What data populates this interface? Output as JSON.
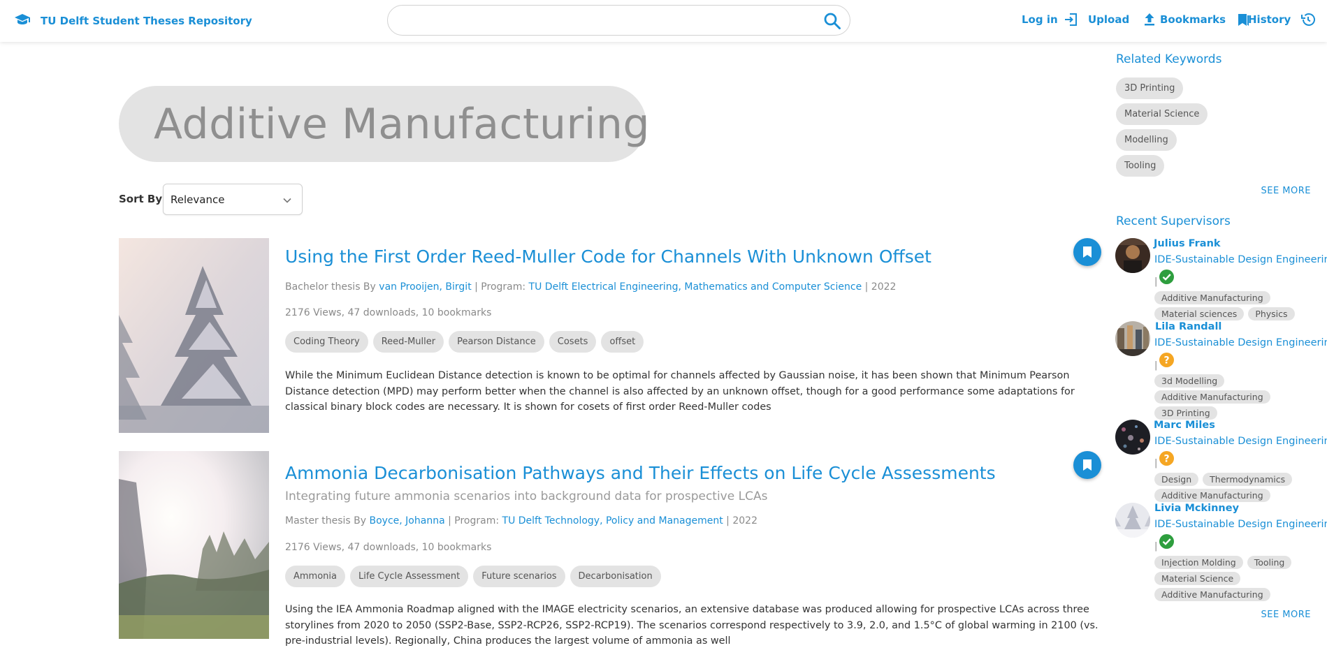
{
  "header": {
    "brand": "TU Delft Student Theses Repository",
    "search": {
      "value": "",
      "placeholder": ""
    },
    "nav": [
      {
        "label": "Log in",
        "icon": "login-icon"
      },
      {
        "label": "Upload",
        "icon": "upload-icon"
      },
      {
        "label": "Bookmarks",
        "icon": "bookmarks-icon"
      },
      {
        "label": "History",
        "icon": "history-icon"
      }
    ]
  },
  "main": {
    "heading": "Additive Manufacturing",
    "sort": {
      "label": "Sort By",
      "selected": "Relevance"
    },
    "results": [
      {
        "title": "Using the First Order Reed-Muller Code for Channels With Unknown Offset",
        "subtitle": "",
        "type_prefix": "Bachelor thesis By ",
        "author": "van Prooijen, Birgit",
        "program_prefix": " | Program: ",
        "program": "TU Delft Electrical Engineering, Mathematics and Computer Science",
        "year": " | 2022",
        "stats": "2176 Views, 47 downloads, 10 bookmarks",
        "tags": [
          "Coding Theory",
          "Reed-Muller",
          "Pearson Distance",
          "Cosets",
          "offset"
        ],
        "abstract": "While the Minimum Euclidean Distance detection is known to be optimal for channels affected by Gaussian noise, it has been shown that Minimum Pearson Distance detection (MPD) may perform better when the channel is also affected by an unknown offset, though for a good performance some adaptations for classical binary block codes are necessary. It is shown for cosets of first order Reed-Muller codes"
      },
      {
        "title": "Ammonia Decarbonisation Pathways and Their Effects on Life Cycle Assessments",
        "subtitle": "Integrating future ammonia scenarios into background data for prospective LCAs",
        "type_prefix": "Master thesis By ",
        "author": "Boyce, Johanna",
        "program_prefix": " | Program: ",
        "program": "TU Delft Technology, Policy and Management",
        "year": " | 2022",
        "stats": "2176 Views, 47 downloads, 10 bookmarks",
        "tags": [
          "Ammonia",
          "Life Cycle Assessment",
          "Future scenarios",
          "Decarbonisation"
        ],
        "abstract": "Using the IEA Ammonia Roadmap aligned with the IMAGE electricity scenarios, an extensive database was produced allowing for prospective LCAs across three storylines from 2020 to 2050 (SSP2-Base, SSP2-RCP26, SSP2-RCP19). The scenarios correspond respectively to 3.9, 2.0, and 1.5°C of global warming in 2100 (vs. pre-industrial levels). Regionally, China produces the largest volume of ammonia as well"
      }
    ]
  },
  "sidebar": {
    "keywords_heading": "Related Keywords",
    "keywords": [
      "3D Printing",
      "Material Science",
      "Modelling",
      "Tooling"
    ],
    "keywords_more": "SEE MORE",
    "supervisors_heading": "Recent Supervisors",
    "supervisors": [
      {
        "name": "Julius Frank",
        "department": "IDE-Sustainable Design Engineering",
        "separator": "|",
        "status": "verified",
        "status_icon": "check-icon",
        "tags": [
          "Additive Manufacturing",
          "Material sciences",
          "Physics"
        ]
      },
      {
        "name": "Lila Randall",
        "department": "IDE-Sustainable Design Engineering",
        "separator": "|",
        "status": "unverified",
        "status_icon": "question-icon",
        "tags": [
          "3d Modelling",
          "Additive Manufacturing",
          "3D Printing"
        ]
      },
      {
        "name": "Marc Miles",
        "department": "IDE-Sustainable Design Engineering",
        "separator": "|",
        "status": "unverified",
        "status_icon": "question-icon",
        "tags": [
          "Design",
          "Thermodynamics",
          "Additive Manufacturing"
        ]
      },
      {
        "name": "Livia Mckinney",
        "department": "IDE-Sustainable Design Engineering",
        "separator": "|",
        "status": "verified",
        "status_icon": "check-icon",
        "tags": [
          "Injection Molding",
          "Tooling",
          "Material Science",
          "Additive Manufacturing"
        ]
      }
    ],
    "supervisors_more": "SEE MORE"
  },
  "colors": {
    "accent": "#1a8fd6",
    "chip": "#e3e3e3",
    "verified": "#2e9e3e",
    "unverified": "#f5a623",
    "hero": "#e3e3e3"
  }
}
